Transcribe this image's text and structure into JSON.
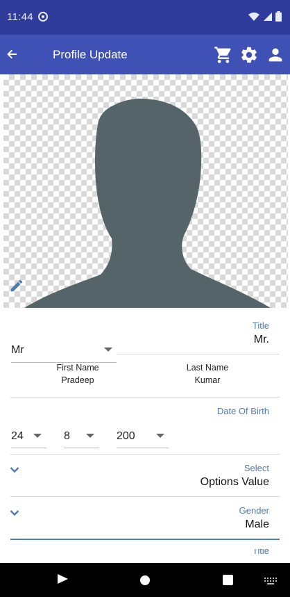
{
  "status_bar": {
    "time": "11:44"
  },
  "app_bar": {
    "title": "Profile Update"
  },
  "icons": {
    "back": "arrow-back-icon",
    "cart": "shopping-cart-icon",
    "settings": "gear-icon",
    "account": "person-icon",
    "edit": "pencil-icon"
  },
  "form": {
    "title": {
      "label": "Title",
      "value": "Mr.",
      "select_value": "Mr"
    },
    "first_name": {
      "label": "First Name",
      "value": "Pradeep"
    },
    "last_name": {
      "label": "Last Name",
      "value": "Kumar"
    },
    "dob": {
      "label": "Date Of Birth",
      "day": "24",
      "month": "8",
      "year": "200"
    },
    "select": {
      "label": "Select",
      "value": "Options Value"
    },
    "gender": {
      "label": "Gender",
      "value": "Male"
    },
    "next_partial_label": "Title"
  },
  "colors": {
    "status_bar": "#2f3c9c",
    "app_bar": "#3f51b5",
    "label_blue": "#4f7cb0",
    "silhouette": "#556468"
  }
}
